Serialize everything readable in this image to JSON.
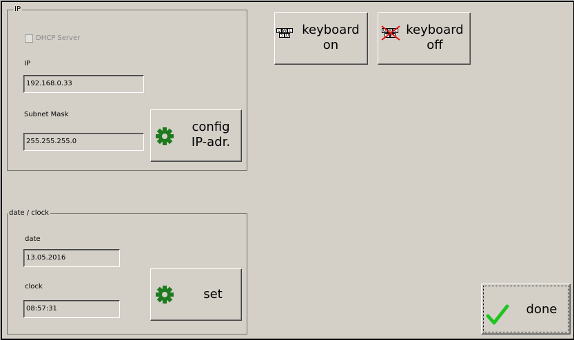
{
  "ip_group": {
    "title": "IP",
    "dhcp_label": "DHCP Server",
    "dhcp_checked": false,
    "ip_label": "IP",
    "ip_value": "192.168.0.33",
    "subnet_label": "Subnet Mask",
    "subnet_value": "255.255.255.0",
    "config_button_line1": "config",
    "config_button_line2": "IP-adr."
  },
  "keyboard": {
    "on_line1": "keyboard",
    "on_line2": "on",
    "off_line1": "keyboard",
    "off_line2": "off",
    "key_row1": [
      "Q",
      "W",
      "E"
    ],
    "key_row2": [
      "S",
      "D"
    ]
  },
  "datetime_group": {
    "title": "date / clock",
    "date_label": "date",
    "date_value": "13.05.2016",
    "clock_label": "clock",
    "clock_value": "08:57:31",
    "set_button": "set"
  },
  "done_button": "done",
  "colors": {
    "gear": "#1e7a1e",
    "check": "#1fc41f",
    "cross": "#e01010"
  },
  "icons": [
    "gear-icon",
    "keyboard-icon",
    "keyboard-off-icon",
    "checkmark-icon"
  ]
}
